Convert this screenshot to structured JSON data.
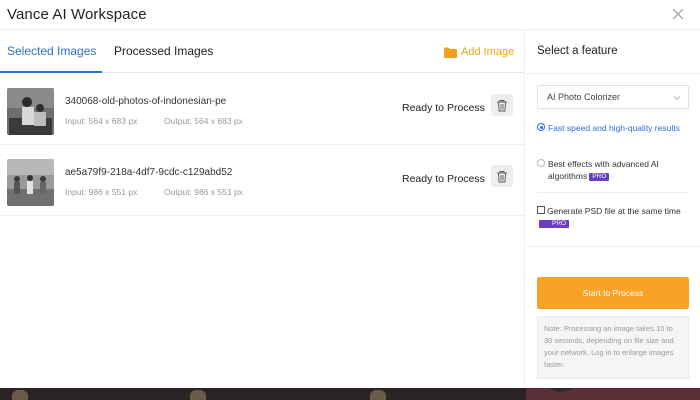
{
  "window": {
    "title": "Vance AI Workspace",
    "close_icon": "close-icon"
  },
  "tabs": [
    {
      "label": "Selected Images",
      "active": true
    },
    {
      "label": "Processed Images",
      "active": false
    }
  ],
  "add_image": {
    "label": "Add Image",
    "icon": "folder-icon",
    "color": "#f0a21a"
  },
  "images": [
    {
      "filename": "340068-old-photos-of-indonesian-pe",
      "input": "Input: 564 x 683 px",
      "output": "Output: 564 x 683 px",
      "status": "Ready to Process"
    },
    {
      "filename": "ae5a79f9-218a-4df7-9cdc-c129abd52",
      "input": "Input: 986 x 551 px",
      "output": "Output: 986 x 551 px",
      "status": "Ready to Process"
    }
  ],
  "feature_panel": {
    "heading": "Select a feature",
    "select_value": "AI Photo Colorizer",
    "options": [
      {
        "label": "Fast speed and high-quality results",
        "selected": true,
        "pro": ""
      },
      {
        "label": "Best effects with advanced AI algorithms",
        "selected": false,
        "pro": "PRO"
      }
    ],
    "psd_checkbox": {
      "label": "Generate PSD file at the same time",
      "checked": false,
      "pro": "PRO"
    },
    "start_button": "Start to Process",
    "note": "Note: Processing an image takes 10 to 30 seconds, depending on file size and your network. Log in to enlarge images faster."
  },
  "colors": {
    "accent": "#2a6fd6",
    "orange": "#f7a327",
    "pro": "#6b3fc2"
  }
}
